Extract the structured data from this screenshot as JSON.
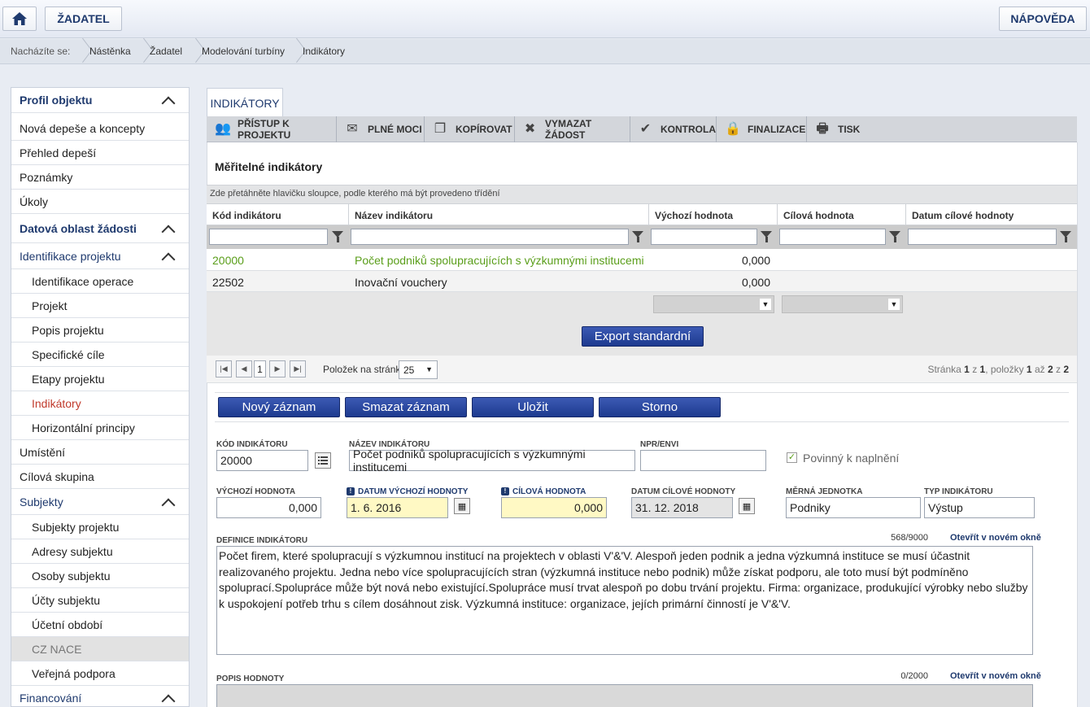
{
  "header": {
    "zadatel_label": "ŽADATEL",
    "help_label": "NÁPOVĚDA"
  },
  "breadcrumb": {
    "prefix": "Nacházíte se:",
    "items": [
      "Nástěnka",
      "Žadatel",
      "Modelování turbíny",
      "Indikátory"
    ]
  },
  "sidebar": {
    "items": [
      {
        "label": "Profil objektu"
      },
      {
        "label": "Nová depeše a koncepty"
      },
      {
        "label": "Přehled depeší"
      },
      {
        "label": "Poznámky"
      },
      {
        "label": "Úkoly"
      },
      {
        "label": "Datová oblast žádosti"
      },
      {
        "label": "Identifikace projektu"
      },
      {
        "label": "Identifikace operace"
      },
      {
        "label": "Projekt"
      },
      {
        "label": "Popis projektu"
      },
      {
        "label": "Specifické cíle"
      },
      {
        "label": "Etapy projektu"
      },
      {
        "label": "Indikátory"
      },
      {
        "label": "Horizontální principy"
      },
      {
        "label": "Umístění"
      },
      {
        "label": "Cílová skupina"
      },
      {
        "label": "Subjekty"
      },
      {
        "label": "Subjekty projektu"
      },
      {
        "label": "Adresy subjektu"
      },
      {
        "label": "Osoby subjektu"
      },
      {
        "label": "Účty subjektu"
      },
      {
        "label": "Účetní období"
      },
      {
        "label": "CZ NACE"
      },
      {
        "label": "Veřejná podpora"
      },
      {
        "label": "Financování"
      }
    ]
  },
  "main": {
    "tab": "INDIKÁTORY",
    "toolbar": [
      "PŘÍSTUP K PROJEKTU",
      "PLNÉ MOCI",
      "KOPÍROVAT",
      "VYMAZAT ŽÁDOST",
      "KONTROLA",
      "FINALIZACE",
      "TISK"
    ],
    "section_title": "Měřitelné indikátory",
    "group_hint": "Zde přetáhněte hlavičku sloupce, podle kterého má být provedeno třídění",
    "columns": [
      "Kód indikátoru",
      "Název indikátoru",
      "Výchozí hodnota",
      "Cílová hodnota",
      "Datum cílové hodnoty"
    ],
    "rows": [
      {
        "code": "20000",
        "name": "Počet podniků spolupracujících s výzkumnými institucemi",
        "start": "0,000",
        "target": "",
        "date": ""
      },
      {
        "code": "22502",
        "name": "Inovační vouchery",
        "start": "0,000",
        "target": "",
        "date": ""
      }
    ],
    "export_label": "Export standardní",
    "pager": {
      "page": "1",
      "per_page_label": "Položek na stránku",
      "per_page": "25",
      "info_a": "Stránka ",
      "info_b": "1",
      "info_c": " z ",
      "info_d": "1",
      "info_e": ", položky ",
      "info_f": "1",
      "info_g": " až ",
      "info_h": "2",
      "info_i": " z ",
      "info_j": "2"
    },
    "buttons": [
      "Nový záznam",
      "Smazat záznam",
      "Uložit",
      "Storno"
    ],
    "form": {
      "kod_label": "KÓD INDIKÁTORU",
      "kod_value": "20000",
      "nazev_label": "NÁZEV INDIKÁTORU",
      "nazev_value": "Počet podniků spolupracujících s výzkumnými institucemi",
      "npr_label": "NPR/ENVI",
      "npr_value": "",
      "povinny_label": "Povinný k naplnění",
      "vych_label": "VÝCHOZÍ HODNOTA",
      "vych_value": "0,000",
      "datum_vych_label": "DATUM VÝCHOZÍ HODNOTY",
      "datum_vych_value": "1. 6. 2016",
      "cil_label": "CÍLOVÁ HODNOTA",
      "cil_value": "0,000",
      "datum_cil_label": "DATUM CÍLOVÉ HODNOTY",
      "datum_cil_value": "31. 12. 2018",
      "merna_label": "MĚRNÁ JEDNOTKA",
      "merna_value": "Podniky",
      "typ_label": "TYP INDIKÁTORU",
      "typ_value": "Výstup",
      "def_label": "DEFINICE INDIKÁTORU",
      "def_count": "568/9000",
      "open_new": "Otevřít v novém okně",
      "def_text": "Počet firem, které spolupracují s výzkumnou institucí na projektech v oblasti V'&'V. Alespoň jeden podnik a jedna výzkumná instituce se musí účastnit realizovaného projektu. Jedna nebo více spolupracujících stran (výzkumná instituce nebo podnik) může získat podporu, ale toto musí být podmíněno spoluprací.Spolupráce může být nová nebo existující.Spolupráce musí trvat alespoň po dobu trvání projektu. Firma: organizace, produkující výrobky nebo služby k uspokojení potřeb trhu s cílem dosáhnout zisk. Výzkumná instituce: organizace, jejích primární činností je V'&'V.",
      "popis_label": "POPIS HODNOTY",
      "popis_count": "0/2000",
      "open_new2": "Otevřít v novém okně"
    }
  },
  "colors": {
    "brand": "#1f3a6e",
    "active": "#c0392b",
    "green": "#5a9e1a",
    "button": "#2a4aa3",
    "highlight": "#fff9c4"
  }
}
